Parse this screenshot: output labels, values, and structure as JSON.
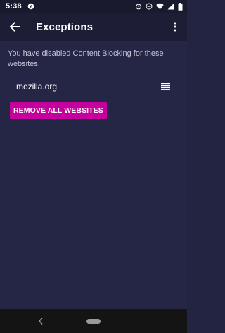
{
  "status_bar": {
    "time": "5:38",
    "icons": [
      "app-notification-icon",
      "alarm-icon",
      "do-not-disturb-icon",
      "wifi-icon",
      "signal-icon",
      "battery-icon"
    ]
  },
  "toolbar": {
    "title": "Exceptions",
    "back_icon": "arrow-left-icon",
    "overflow_icon": "vertical-dots-icon"
  },
  "content": {
    "description": "You have disabled Content Blocking for these websites.",
    "sites": [
      {
        "name": "mozilla.org",
        "handle_icon": "reorder-icon"
      }
    ],
    "remove_all_label": "REMOVE ALL WEBSITES"
  },
  "nav_bar": {
    "back_icon": "chevron-left-icon",
    "home_icon": "home-pill-icon"
  },
  "colors": {
    "background": "#252546",
    "toolbar": "#1d1d35",
    "accent_button": "#c6009c",
    "description_text": "#c4c4d6"
  }
}
